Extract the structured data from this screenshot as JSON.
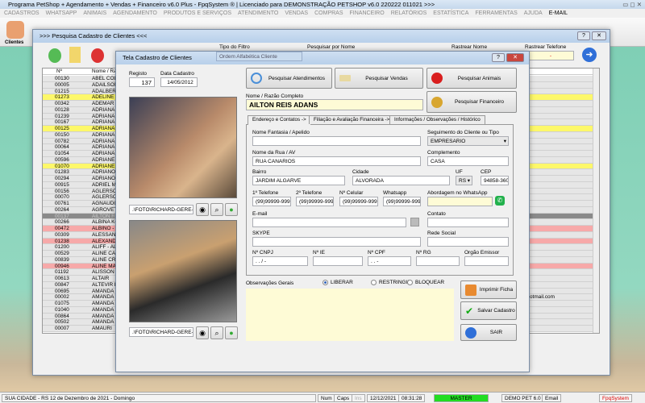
{
  "app": {
    "title": "Programa PetShop + Agendamento + Vendas + Financeiro v6.0 Plus - FpqSystem ® | Licenciado para  DEMONSTRAÇÃO PETSHOP v6.0 220222 011021 >>>"
  },
  "menu": [
    "CADASTROS",
    "WHATSAPP",
    "ANIMAIS",
    "AGENDAMENTO",
    "PRODUTOS E SERVIÇOS",
    "ATENDIMENTO",
    "VENDAS",
    "COMPRAS",
    "FINANCEIRO",
    "RELATÓRIOS",
    "ESTATÍSTICA",
    "FERRAMENTAS",
    "AJUDA",
    "E-MAIL"
  ],
  "toolbar": {
    "clientes_label": "Clientes"
  },
  "search_window": {
    "title": ">>> Pesquisa Cadastro de Clientes <<<",
    "filter_type_label": "Tipo do Filtro",
    "filter_type_value": "Ordem Alfabética Cliente",
    "search_name_label": "Pesquisar por Nome",
    "track_name_label": "Rastrear Nome",
    "track_phone_label": "Rastrear Telefone",
    "track_phone_value": "-",
    "columns": [
      "Nº",
      "Nome / Razão Social"
    ],
    "rows": [
      {
        "n": "00130",
        "name": "ABEL COLTRO",
        "hl": ""
      },
      {
        "n": "00005",
        "name": "ADAILSON",
        "hl": ""
      },
      {
        "n": "01215",
        "name": "ADALBERTO CHIM",
        "hl": ""
      },
      {
        "n": "01273",
        "name": "ADELINE",
        "hl": "yellow"
      },
      {
        "n": "00342",
        "name": "ADEMAR INACIO B",
        "hl": ""
      },
      {
        "n": "00128",
        "name": "ADRIANA",
        "hl": ""
      },
      {
        "n": "01239",
        "name": "ADRIANA - BIJU",
        "hl": ""
      },
      {
        "n": "00167",
        "name": "ADRIANA BONFIM",
        "hl": ""
      },
      {
        "n": "00125",
        "name": "ADRIANA CRIGUE",
        "hl": "yellow"
      },
      {
        "n": "00150",
        "name": "ADRIANA KARAS N",
        "hl": ""
      },
      {
        "n": "00782",
        "name": "ADRIANA MARAVIL",
        "hl": ""
      },
      {
        "n": "00064",
        "name": "ADRIANA MARCOV",
        "hl": ""
      },
      {
        "n": "01054",
        "name": "ADRIANA MIOTTO",
        "hl": ""
      },
      {
        "n": "00596",
        "name": "ADRIANE APAREC",
        "hl": ""
      },
      {
        "n": "01070",
        "name": "ADRIANE KOOP",
        "hl": "yellow"
      },
      {
        "n": "01283",
        "name": "ADRIANO COLPAN",
        "hl": ""
      },
      {
        "n": "00294",
        "name": "ADRIANO L MARU",
        "hl": ""
      },
      {
        "n": "00915",
        "name": "ADRIEL MARTINS",
        "hl": ""
      },
      {
        "n": "00156",
        "name": "AGLERSON - MÃE",
        "hl": ""
      },
      {
        "n": "00070",
        "name": "AGLERSON SOAR",
        "hl": ""
      },
      {
        "n": "00761",
        "name": "AGNAUDO FERRA",
        "hl": ""
      },
      {
        "n": "00264",
        "name": "AGROVET",
        "hl": ""
      },
      {
        "n": "00137",
        "name": "AILTON REIS ADAN",
        "hl": "selected"
      },
      {
        "n": "00266",
        "name": "ALBINA KOVALKI",
        "hl": ""
      },
      {
        "n": "00472",
        "name": "ALBINO - COMERC",
        "hl": "pink"
      },
      {
        "n": "00309",
        "name": "ALESSANDRO ESN",
        "hl": ""
      },
      {
        "n": "01238",
        "name": "ALEXANDRE",
        "hl": "pink"
      },
      {
        "n": "01200",
        "name": "ALIFF - ALAN - CHI",
        "hl": ""
      },
      {
        "n": "00529",
        "name": "ALINE CARLA",
        "hl": ""
      },
      {
        "n": "00839",
        "name": "ALINE CRISTINA M",
        "hl": ""
      },
      {
        "n": "00946",
        "name": "ALINE MARIARA",
        "hl": "pink"
      },
      {
        "n": "01192",
        "name": "ALISSON HAVRES",
        "hl": ""
      },
      {
        "n": "00613",
        "name": "ALTAIR",
        "hl": ""
      },
      {
        "n": "00847",
        "name": "ALTEVIR BTISTA -",
        "hl": ""
      },
      {
        "n": "00695",
        "name": "AMANDA",
        "hl": ""
      },
      {
        "n": "00002",
        "name": "AMANDA B CAPELI",
        "hl": "",
        "email": "otmail.com"
      },
      {
        "n": "01075",
        "name": "AMANDA DIBAS",
        "hl": ""
      },
      {
        "n": "01040",
        "name": "AMANDA P PETRA",
        "hl": ""
      },
      {
        "n": "00864",
        "name": "AMANDA SEQUINE",
        "hl": ""
      },
      {
        "n": "00502",
        "name": "AMANDA SILVA",
        "hl": ""
      },
      {
        "n": "00007",
        "name": "AMAURI",
        "hl": ""
      }
    ]
  },
  "dialog": {
    "title": "Tela Cadastro de Clientes",
    "registro_label": "Registo",
    "registro": "137",
    "data_label": "Data Cadastro",
    "data": "14/05/2012",
    "photo1_path": ".\\FOTO\\RICHARD-GERE-CAI",
    "photo2_path": ".\\FOTO\\RICHARD-GERE-CAI",
    "btn_atendimentos": "Pesquisar  Atendimentos",
    "btn_vendas": "Pesquisar Vendas",
    "btn_animais": "Pesquisar Animais",
    "btn_financeiro": "Pesquisar  Financeiro",
    "nome_label": "Nome / Razão Completo",
    "nome": "AILTON REIS ADANS",
    "tabs": [
      "Endereço e Contatos ->",
      "Filiação e Avaliação Financeira ->",
      "Informações / Observações / Histórico"
    ],
    "fields": {
      "fantasia_label": "Nome Fantasia / Apelido",
      "fantasia": "",
      "segmento_label": "Seguimento do Cliente ou Tipo",
      "segmento": "EMPRESARIO",
      "rua_label": "Nome da Rua / AV",
      "rua": "RUA CANARIOS",
      "complemento_label": "Complemento",
      "complemento": "CASA",
      "bairro_label": "Bairro",
      "bairro": "JARDIM ALGARVE",
      "cidade_label": "Cidade",
      "cidade": "ALVORADA",
      "uf_label": "UF",
      "uf": "RS",
      "cep_label": "CEP",
      "cep": "94858-360",
      "tel1_label": "1º Telefone",
      "tel1": "(99)99999-9999",
      "tel2_label": "2º Telefone",
      "tel2": "(99)99999-9999",
      "cel_label": "Nº Celular",
      "cel": "(99)99999-9999",
      "whats_label": "Whatsapp",
      "whats": "(99)99999-9999",
      "abordagem_label": "Abordagem no WhatsApp",
      "abordagem": "",
      "email_label": "E-mail",
      "email": "",
      "contato_label": "Contato",
      "contato": "",
      "skype_label": "SKYPE",
      "skype": "",
      "rede_label": "Rede Social",
      "rede": "",
      "cnpj_label": "Nº CNPJ",
      "cnpj": "  .   .   /    -",
      "ie_label": "Nº IE",
      "ie": "",
      "cpf_label": "Nº CPF",
      "cpf": "   .   .   -",
      "rg_label": "Nº RG",
      "rg": "",
      "orgao_label": "Orgão Emissor",
      "orgao": ""
    },
    "obs_label": "Observações Gerais",
    "radios": [
      {
        "label": "LIBERAR",
        "checked": true
      },
      {
        "label": "RESTRINGIR",
        "checked": false
      },
      {
        "label": "BLOQUEAR",
        "checked": false
      }
    ],
    "btn_imprimir": "Imprimir Ficha",
    "btn_salvar": "Salvar Cadastro",
    "btn_sair": "SAIR"
  },
  "status": {
    "location": "SUA CIDADE - RS 12 de Dezembro de 2021 - Domingo",
    "num": "Num",
    "caps": "Caps",
    "ins": "Ins",
    "date": "12/12/2021",
    "time": "08:31:28",
    "user": "MASTER",
    "version": "DEMO PET 6.0",
    "email": "Email",
    "brand": "FpqSystem"
  },
  "colors": {
    "yellow_row": "#fdf86a",
    "pink_row": "#f7a9a9",
    "selected_row": "#8a8a8a",
    "master_green": "#22dd22",
    "field_yellow": "#fefbd6"
  }
}
